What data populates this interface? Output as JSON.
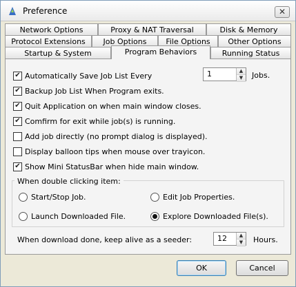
{
  "window": {
    "title": "Preference",
    "close_glyph": "✕"
  },
  "tabs": {
    "row1": [
      "Network Options",
      "Proxy & NAT Traversal",
      "Disk & Memory"
    ],
    "row2": [
      "Protocol Extensions",
      "Job Options",
      "File Options",
      "Other Options"
    ],
    "row3": [
      "Startup & System",
      "Program Behaviors",
      "Running Status"
    ],
    "active": "Program Behaviors"
  },
  "options": [
    {
      "label": "Automatically Save Job List Every",
      "checked": true
    },
    {
      "label": "Backup Job List When Program exits.",
      "checked": true
    },
    {
      "label": "Quit Application on when main window closes.",
      "checked": true
    },
    {
      "label": "Comfirm for exit while job(s) is running.",
      "checked": true
    },
    {
      "label": "Add job directly (no prompt dialog is displayed).",
      "checked": false
    },
    {
      "label": "Display balloon tips when mouse over trayicon.",
      "checked": false
    },
    {
      "label": "Show Mini StatusBar when hide main window.",
      "checked": true
    }
  ],
  "save_every": {
    "value": "1",
    "unit": "Jobs."
  },
  "double_click": {
    "title": "When double clicking item:",
    "options": [
      {
        "label": "Start/Stop Job.",
        "selected": false
      },
      {
        "label": "Edit Job Properties.",
        "selected": false
      },
      {
        "label": "Launch Downloaded File.",
        "selected": false
      },
      {
        "label": "Explore Downloaded File(s).",
        "selected": true
      }
    ]
  },
  "seeder": {
    "label": "When download done, keep alive as a seeder:",
    "value": "12",
    "unit": "Hours."
  },
  "buttons": {
    "ok": "OK",
    "cancel": "Cancel"
  }
}
